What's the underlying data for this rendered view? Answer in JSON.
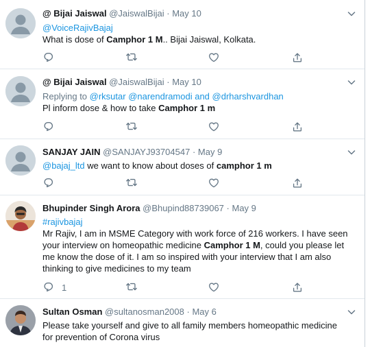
{
  "tweets": [
    {
      "name": "@ Bijai Jaiswal",
      "handle": "@JaiswalBijai",
      "separator": "·",
      "date": "May 10",
      "reply_context": "@VoiceRajivBajaj",
      "body_prefix": "What is dose of ",
      "body_bold": "Camphor 1 M",
      "body_suffix": ".. Bijai Jaiswal, Kolkata.",
      "reply_count": ""
    },
    {
      "name": "@ Bijai Jaiswal",
      "handle": "@JaiswalBijai",
      "separator": "·",
      "date": "May 10",
      "replying_label": "Replying to ",
      "replying_handles": "@rksutar @narendramodi and @drharshvardhan",
      "body_prefix": "Pl inform dose & how to take ",
      "body_bold": "Camphor 1 m",
      "reply_count": ""
    },
    {
      "name": "SANJAY JAIN",
      "handle": "@SANJAYJ93704547",
      "separator": "·",
      "date": "May 9",
      "mention": "@bajaj_ltd",
      "body_prefix": " we want to know about doses of ",
      "body_bold": "camphor 1 m",
      "reply_count": ""
    },
    {
      "name": "Bhupinder Singh Arora",
      "handle": "@Bhupind88739067",
      "separator": "·",
      "date": "May 9",
      "hashtag": "#rajivbajaj",
      "line1": "Mr Rajiv, I am in MSME Category with work force of 216 workers. I have seen",
      "line2_prefix": "your interview on homeopathic medicine ",
      "line2_bold": "Camphor 1 M",
      "line2_suffix": ", could you please let",
      "line3": "me know the dose of it. I am so inspired with your interview  that I am also",
      "line4": "thinking to give medicines to my team",
      "reply_count": "1"
    },
    {
      "name": "Sultan Osman",
      "handle": "@sultanosman2008",
      "separator": "·",
      "date": "May 6",
      "line1": "Please take yourself and give to all family members homeopathic medicine",
      "line2": "for prevention of Corona virus"
    }
  ],
  "icons": {
    "reply": "reply-icon",
    "retweet": "retweet-icon",
    "like": "heart-icon",
    "share": "share-icon",
    "menu": "chevron-down-icon"
  },
  "colors": {
    "link": "#1b95e0",
    "secondary_text": "#657786",
    "divider": "#e1e8ed",
    "default_avatar": "#ccd6dd"
  }
}
